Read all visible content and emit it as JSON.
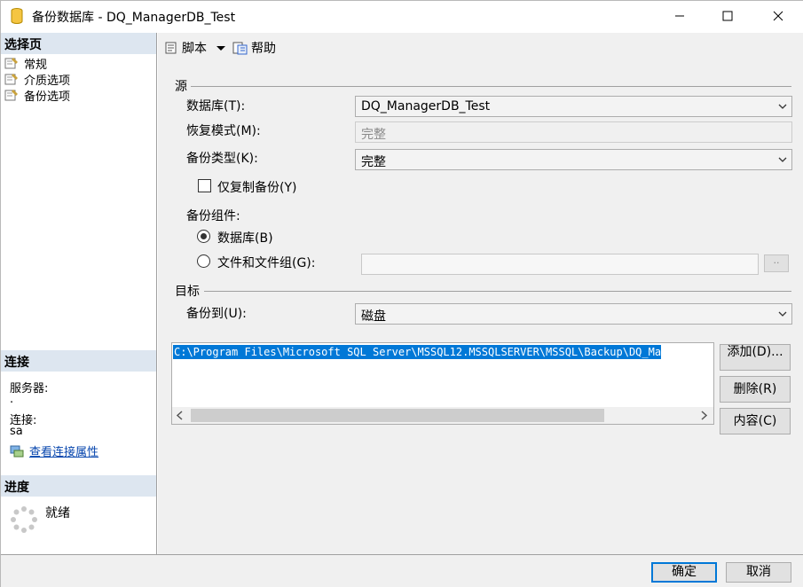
{
  "window": {
    "title": "备份数据库 - DQ_ManagerDB_Test"
  },
  "left": {
    "select_page_header": "选择页",
    "nav_items": [
      {
        "label": "常规"
      },
      {
        "label": "介质选项"
      },
      {
        "label": "备份选项"
      }
    ],
    "connection_header": "连接",
    "server_label": "服务器:",
    "server_value": ".",
    "connection_label": "连接:",
    "connection_value": "sa",
    "view_properties_link": "查看连接属性",
    "progress_header": "进度",
    "progress_status": "就绪"
  },
  "toolbar": {
    "script_label": "脚本",
    "help_label": "帮助"
  },
  "source": {
    "group_label": "源",
    "database_label": "数据库(T):",
    "database_value": "DQ_ManagerDB_Test",
    "recovery_label": "恢复模式(M):",
    "recovery_value": "完整",
    "backup_type_label": "备份类型(K):",
    "backup_type_value": "完整",
    "copy_only_label": "仅复制备份(Y)",
    "component_label": "备份组件:",
    "component_database_label": "数据库(B)",
    "component_files_label": "文件和文件组(G):",
    "files_button_label": "··"
  },
  "destination": {
    "group_label": "目标",
    "backup_to_label": "备份到(U):",
    "backup_to_value": "磁盘",
    "paths": [
      "C:\\Program Files\\Microsoft SQL Server\\MSSQL12.MSSQLSERVER\\MSSQL\\Backup\\DQ_Ma"
    ],
    "add_button": "添加(D)...",
    "remove_button": "删除(R)",
    "contents_button": "内容(C)"
  },
  "footer": {
    "ok_button": "确定",
    "cancel_button": "取消"
  },
  "colors": {
    "selection": "#0078d7",
    "section_header": "#dde6f0"
  }
}
